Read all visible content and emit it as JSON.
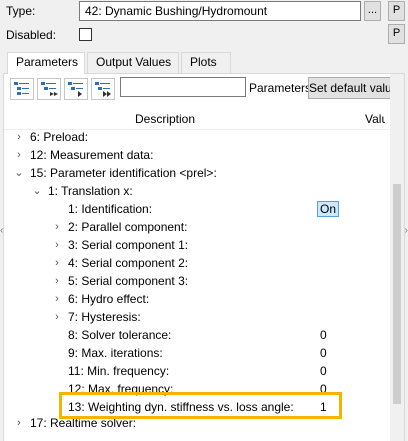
{
  "header": {
    "type_label": "Type:",
    "type_value": "42: Dynamic Bushing/Hydromount",
    "browse_btn": "...",
    "p_btn": "P",
    "disabled_label": "Disabled:",
    "disabled_p_btn": "P"
  },
  "tabs": [
    {
      "label": "Parameters",
      "active": true
    },
    {
      "label": "Output Values",
      "active": false
    },
    {
      "label": "Plots",
      "active": false
    }
  ],
  "toolbar": {
    "icons": [
      "expand-all-icon",
      "collapse-all-icon",
      "expand-level-icon",
      "expand-deep-icon"
    ],
    "search_value": "",
    "parameters_label": "Parameters:",
    "default_button": "Set default values"
  },
  "grid": {
    "col_description": "Description",
    "col_value": "Value"
  },
  "rows": [
    {
      "text": "6: Preload:",
      "arrow": "›",
      "value": ""
    },
    {
      "text": "12: Measurement data:",
      "arrow": "›",
      "value": ""
    },
    {
      "text": "15: Parameter identification <prel>:",
      "arrow": "⌄",
      "value": ""
    },
    {
      "text": "1: Translation x:",
      "arrow": "⌄",
      "value": ""
    },
    {
      "text": "1: Identification:",
      "arrow": "",
      "value": "On"
    },
    {
      "text": "2: Parallel component:",
      "arrow": "›",
      "value": ""
    },
    {
      "text": "3: Serial component 1:",
      "arrow": "›",
      "value": ""
    },
    {
      "text": "4: Serial component 2:",
      "arrow": "›",
      "value": ""
    },
    {
      "text": "5: Serial component 3:",
      "arrow": "›",
      "value": ""
    },
    {
      "text": "6: Hydro effect:",
      "arrow": "›",
      "value": ""
    },
    {
      "text": "7: Hysteresis:",
      "arrow": "›",
      "value": ""
    },
    {
      "text": "8: Solver tolerance:",
      "arrow": "",
      "value": "0"
    },
    {
      "text": "9: Max. iterations:",
      "arrow": "",
      "value": "0"
    },
    {
      "text": "11: Min. frequency:",
      "arrow": "",
      "value": "0"
    },
    {
      "text": "12: Max. frequency:",
      "arrow": "",
      "value": "0"
    },
    {
      "text": "13: Weighting dyn. stiffness vs. loss angle:",
      "arrow": "",
      "value": "1"
    },
    {
      "text": "17: Realtime solver:",
      "arrow": "›",
      "value": ""
    }
  ],
  "colors": {
    "highlight": "#f5b400",
    "selection": "#cce8ff"
  }
}
